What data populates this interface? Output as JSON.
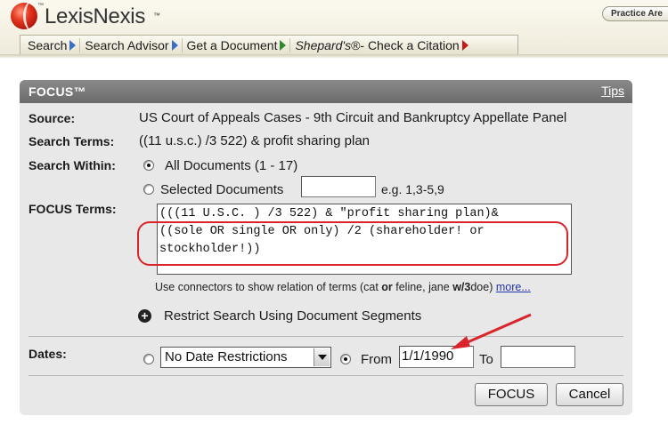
{
  "header": {
    "brand": "LexisNexis",
    "tm": "™",
    "practice_label": "Practice Are",
    "nav": [
      {
        "label": "Search"
      },
      {
        "label": "Search Advisor"
      },
      {
        "label": "Get a Document"
      },
      {
        "label_italic": "Shepard's",
        "label_rest": "®- Check a Citation"
      }
    ]
  },
  "panel": {
    "title": "FOCUS™",
    "tips": "Tips",
    "source_label": "Source:",
    "source_value": "US Court of Appeals Cases - 9th Circuit and Bankruptcy Appellate Panel",
    "terms_label": "Search Terms:",
    "terms_value": "((11 u.s.c.) /3 522) & profit sharing plan",
    "within_label": "Search Within:",
    "all_docs": "All Documents (1 - 17)",
    "selected_docs": "Selected Documents",
    "selected_hint": "e.g. 1,3-5,9",
    "focus_terms_label": "FOCUS Terms:",
    "focus_terms_value": "(((11 U.S.C. ) /3 522) & \"profit sharing plan)&\n((sole OR single OR only) /2 (shareholder! or\nstockholder!))",
    "hint_pre": "Use connectors to show relation of terms (cat ",
    "hint_or": "or",
    "hint_mid": " feline, jane ",
    "hint_w3": "w/3",
    "hint_post": "doe) ",
    "hint_more": "more...",
    "restrict": "Restrict Search Using Document Segments",
    "dates_label": "Dates:",
    "date_select": "No Date Restrictions",
    "from_label": "From",
    "from_value": "1/1/1990",
    "to_label": "To",
    "to_value": "",
    "focus_button": "FOCUS",
    "cancel_button": "Cancel"
  },
  "colors": {
    "annotation_red": "#d8242a",
    "panel_title": "#7a7a7a",
    "panel_bg": "#e8e8e8"
  }
}
